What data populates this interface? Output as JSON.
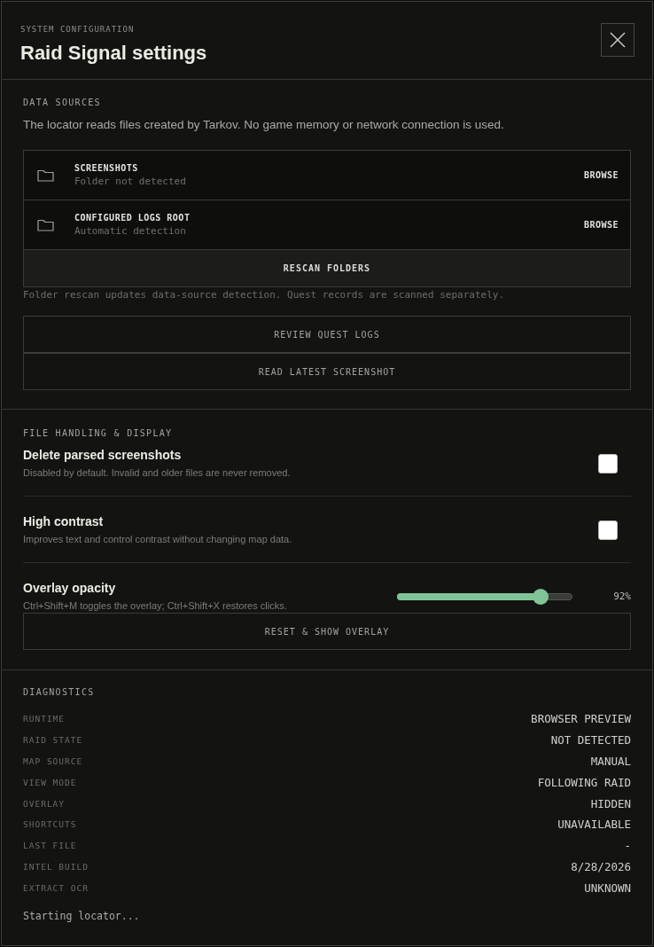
{
  "header": {
    "eyebrow": "SYSTEM CONFIGURATION",
    "title": "Raid Signal settings"
  },
  "data_sources": {
    "heading": "DATA SOURCES",
    "description": "The locator reads files created by Tarkov. No game memory or network connection is used.",
    "folders": [
      {
        "name": "SCREENSHOTS",
        "status": "Folder not detected",
        "action": "BROWSE"
      },
      {
        "name": "CONFIGURED LOGS ROOT",
        "status": "Automatic detection",
        "action": "BROWSE"
      }
    ],
    "rescan_button": "RESCAN FOLDERS",
    "note": "Folder rescan updates data-source detection. Quest records are scanned separately.",
    "buttons": [
      "REVIEW QUEST LOGS",
      "READ LATEST SCREENSHOT"
    ]
  },
  "file_handling": {
    "heading": "FILE HANDLING & DISPLAY",
    "settings": [
      {
        "kind": "checkbox",
        "label": "Delete parsed screenshots",
        "description": "Disabled by default. Invalid and older files are never removed.",
        "checked": false
      },
      {
        "kind": "checkbox",
        "label": "High contrast",
        "description": "Improves text and control contrast without changing map data.",
        "checked": false
      },
      {
        "kind": "slider",
        "label": "Overlay opacity",
        "description": "Ctrl+Shift+M toggles the overlay; Ctrl+Shift+X restores clicks.",
        "level": 0.82,
        "reading": "92%"
      }
    ],
    "reset_button": "RESET & SHOW OVERLAY"
  },
  "diagnostics": {
    "heading": "DIAGNOSTICS",
    "rows": [
      {
        "label": "RUNTIME",
        "value": "BROWSER PREVIEW"
      },
      {
        "label": "RAID STATE",
        "value": "NOT DETECTED"
      },
      {
        "label": "MAP SOURCE",
        "value": "MANUAL"
      },
      {
        "label": "VIEW MODE",
        "value": "FOLLOWING RAID"
      },
      {
        "label": "OVERLAY",
        "value": "HIDDEN"
      },
      {
        "label": "SHORTCUTS",
        "value": "UNAVAILABLE"
      },
      {
        "label": "LAST FILE",
        "value": "-"
      },
      {
        "label": "INTEL BUILD",
        "value": "8/28/2026"
      },
      {
        "label": "EXTRACT OCR",
        "value": "UNKNOWN"
      }
    ],
    "status": "Starting locator..."
  }
}
